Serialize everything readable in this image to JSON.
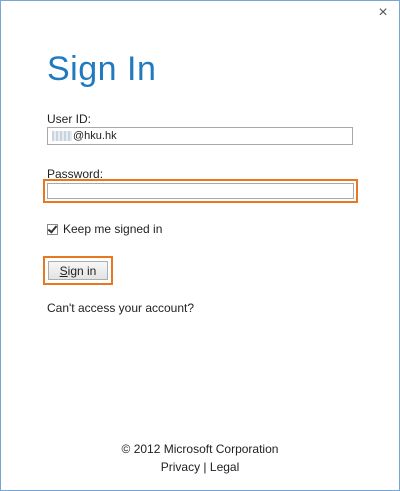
{
  "window": {
    "close_glyph": "×"
  },
  "title": "Sign In",
  "userid": {
    "label": "User ID:",
    "value_suffix": "@hku.hk"
  },
  "password": {
    "label": "Password:",
    "value": ""
  },
  "keep_signed_in": {
    "label": "Keep me signed in",
    "checked": true
  },
  "signin_button": {
    "label_first": "S",
    "label_rest": "ign in"
  },
  "cant_access": "Can't access your account?",
  "footer": {
    "copyright": "© 2012 Microsoft Corporation",
    "privacy": "Privacy",
    "separator": "|",
    "legal": "Legal"
  },
  "colors": {
    "accent": "#1f7ac0",
    "highlight": "#e87722"
  }
}
